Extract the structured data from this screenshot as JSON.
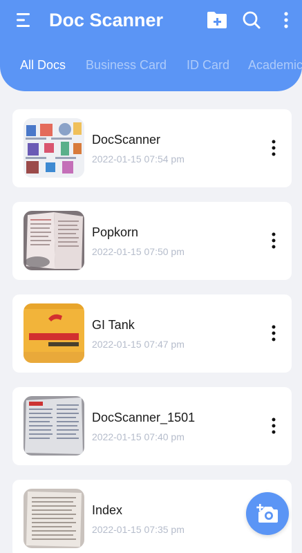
{
  "app": {
    "title": "Doc Scanner"
  },
  "colors": {
    "primary": "#5b95f5",
    "tab_inactive": "#aecbfa",
    "date_text": "#b5bccb"
  },
  "icons": {
    "menu": "menu-icon",
    "new_folder": "folder-plus-icon",
    "search": "search-icon",
    "more": "more-vertical-icon",
    "camera": "camera-plus-icon"
  },
  "tabs": [
    {
      "label": "All Docs",
      "active": true
    },
    {
      "label": "Business Card",
      "active": false
    },
    {
      "label": "ID Card",
      "active": false
    },
    {
      "label": "Academic",
      "active": false
    }
  ],
  "documents": [
    {
      "name": "DocScanner",
      "date": "2022-01-15  07:54 pm"
    },
    {
      "name": "Popkorn",
      "date": "2022-01-15  07:50 pm"
    },
    {
      "name": "GI Tank",
      "date": "2022-01-15  07:47 pm"
    },
    {
      "name": "DocScanner_1501",
      "date": "2022-01-15  07:40 pm"
    },
    {
      "name": "Index",
      "date": "2022-01-15  07:35 pm"
    }
  ]
}
